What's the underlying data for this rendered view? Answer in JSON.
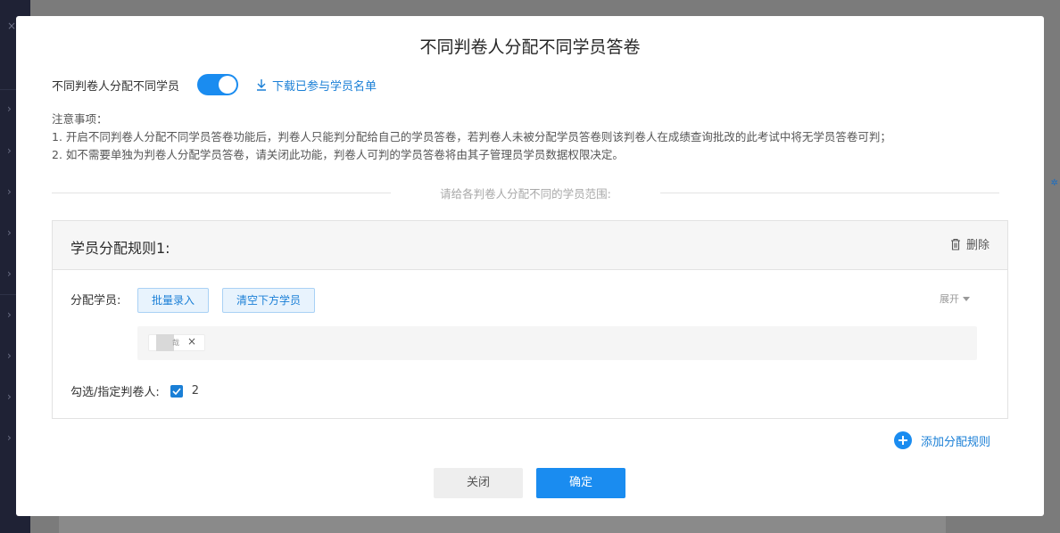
{
  "modal": {
    "title": "不同判卷人分配不同学员答卷",
    "switch_label": "不同判卷人分配不同学员",
    "toggle_on": true,
    "download_link": "下载已参与学员名单",
    "notes_title": "注意事项：",
    "notes": [
      "1. 开启不同判卷人分配不同学员答卷功能后，判卷人只能判分配给自己的学员答卷，若判卷人未被分配学员答卷则该判卷人在成绩查询批改的此考试中将无学员答卷可判；",
      "2. 如不需要单独为判卷人分配学员答卷，请关闭此功能，判卷人可判的学员答卷将由其子管理员学员数据权限决定。"
    ],
    "range_hint": "请给各判卷人分配不同的学员范围:",
    "rule": {
      "title": "学员分配规则1:",
      "delete_label": "删除",
      "assign_label": "分配学员:",
      "batch_button": "批量录入",
      "clear_button": "清空下方学员",
      "expand_label": "展开",
      "student_tag_char": "哉",
      "student_tag_close": "×",
      "grader_label": "勾选/指定判卷人:",
      "grader_checked": true,
      "grader_name": "2"
    },
    "add_rule_label": "添加分配规则",
    "close_button": "关闭",
    "confirm_button": "确定"
  },
  "colors": {
    "primary": "#1a8cf0",
    "link": "#1a7fd6",
    "overlay": "#7b7b7b",
    "sidebar": "#1f2235"
  },
  "icons": {
    "download": "download-arrow-icon",
    "delete": "trash-icon",
    "add": "plus-circle-icon",
    "check": "checkmark-icon",
    "expand": "caret-down-icon"
  }
}
